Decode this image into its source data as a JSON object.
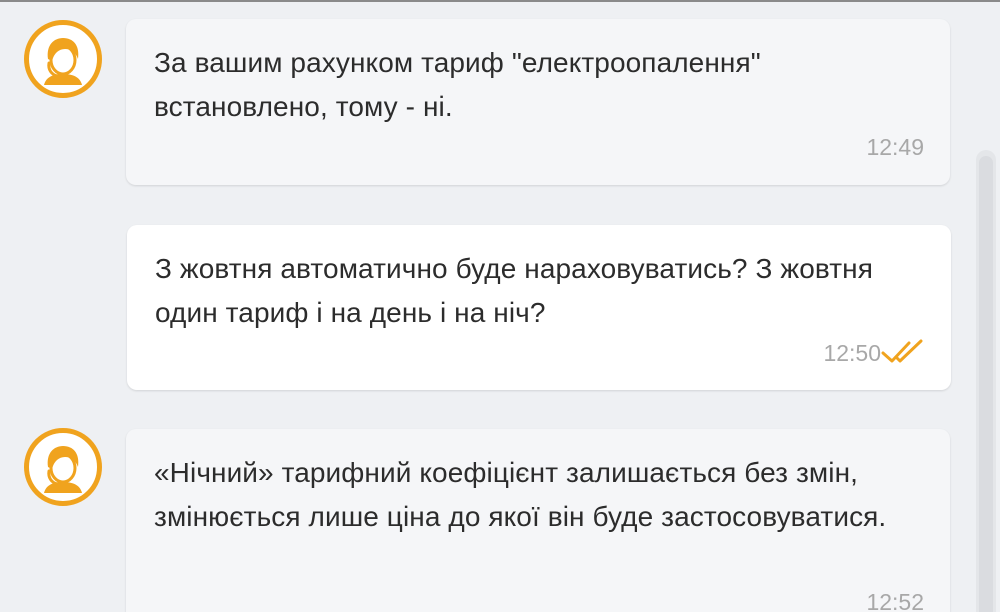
{
  "conversation": {
    "messages": [
      {
        "sender": "operator",
        "text": "За вашим рахунком тариф \"електроопалення\" встановлено, тому - ні.",
        "time": "12:49"
      },
      {
        "sender": "user",
        "text": "З жовтня автоматично буде нараховуватись? З жовтня один тариф і на день і на ніч?",
        "time": "12:50",
        "status_icon": "double-check-icon"
      },
      {
        "sender": "operator",
        "text": "«Нічний» тарифний коефіцієнт залишається без змін, змінюється лише ціна до якої він буде застосовуватися.",
        "time": "12:52"
      }
    ]
  },
  "theme": {
    "accent": "#f0a31e",
    "incoming_bubble": "#f5f6f8",
    "outgoing_bubble": "#ffffff",
    "background": "#eef0f3",
    "text": "#2c2c2c",
    "time_text": "#a8a8a8"
  }
}
